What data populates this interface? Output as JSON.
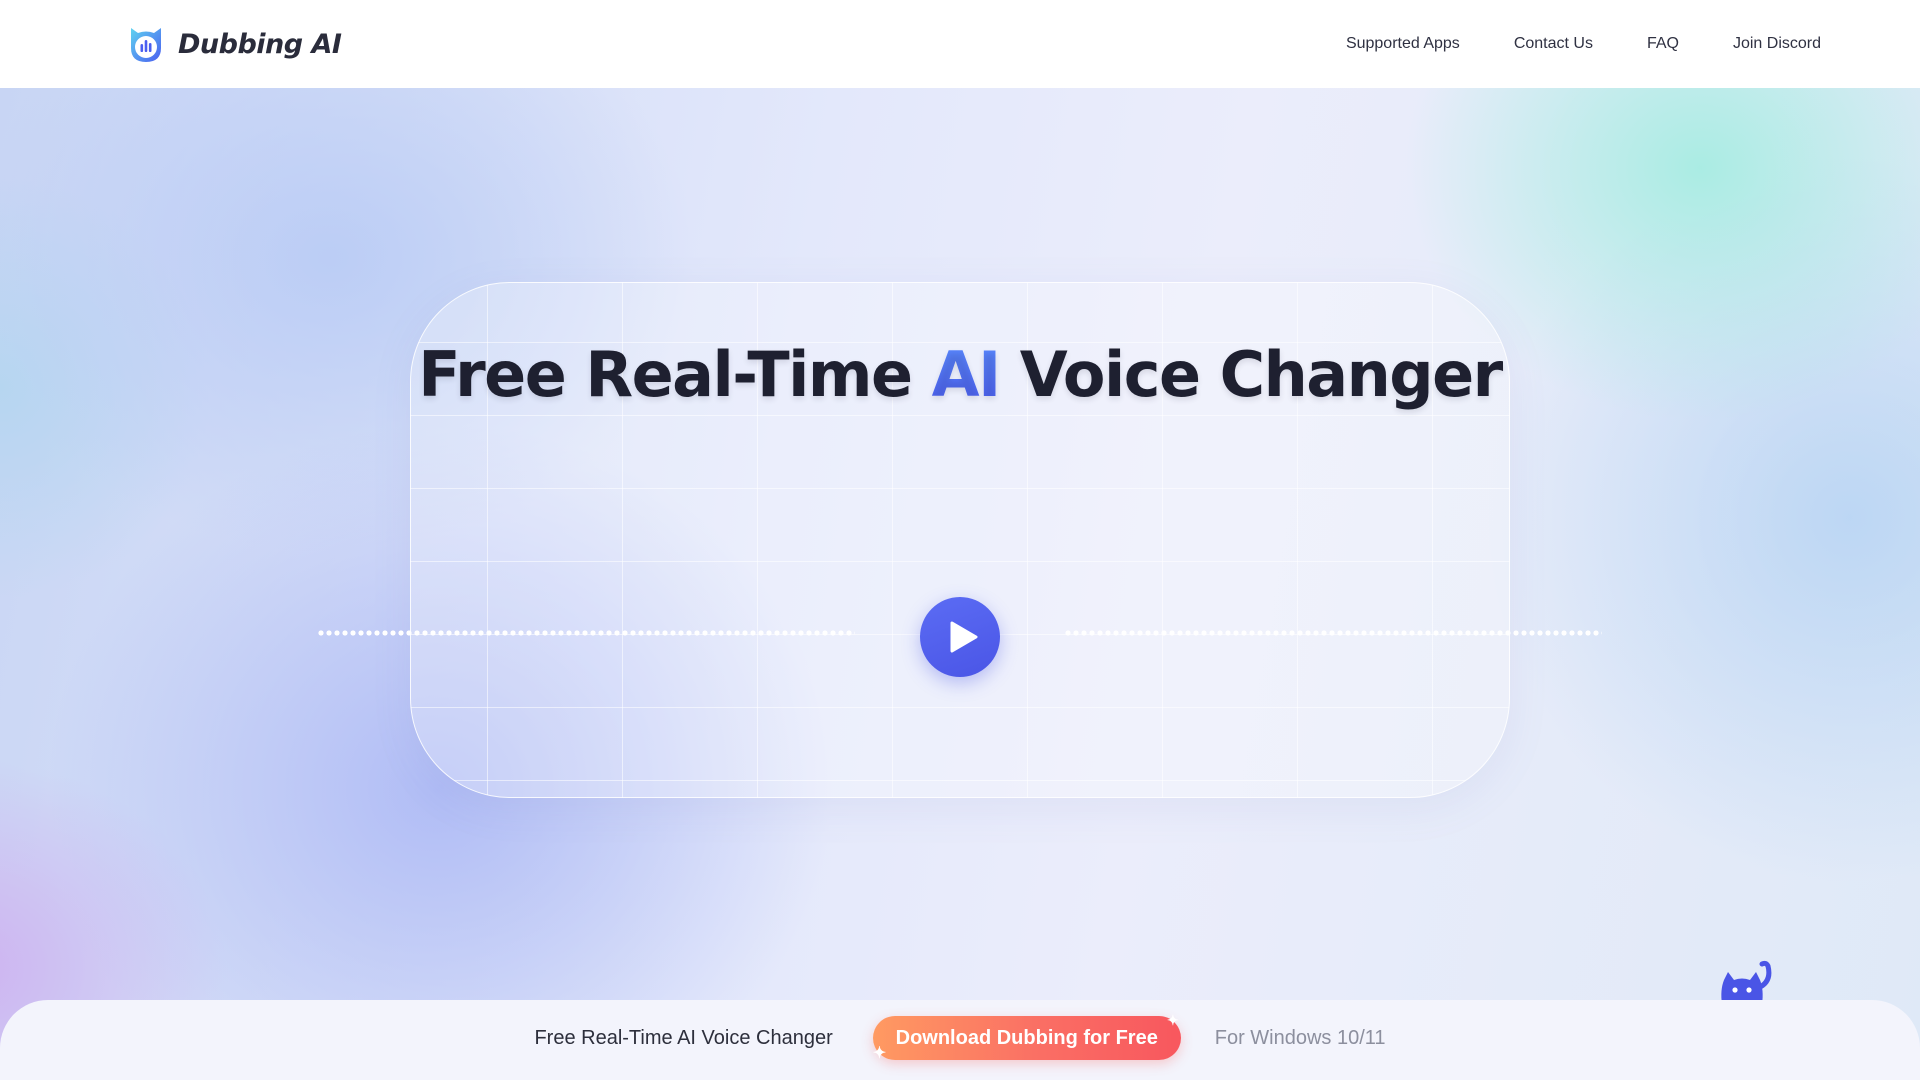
{
  "header": {
    "brand_name": "Dubbing AI",
    "logo_icon": "cat-soundwave-logo-icon",
    "nav": [
      {
        "label": "Supported Apps"
      },
      {
        "label": "Contact Us"
      },
      {
        "label": "FAQ"
      },
      {
        "label": "Join Discord"
      }
    ]
  },
  "hero": {
    "title_part1": "Free Real-Time ",
    "title_accent": "AI",
    "title_part2": " Voice Changer",
    "play_icon": "play-icon",
    "accent_color": "#4b5cf0"
  },
  "bottom_bar": {
    "text": "Free Real-Time AI Voice Changer",
    "download_label": "Download Dubbing for Free",
    "platform": "For Windows 10/11",
    "download_color": "#fa6e64"
  },
  "mascot_icon": "cat-mascot-icon"
}
